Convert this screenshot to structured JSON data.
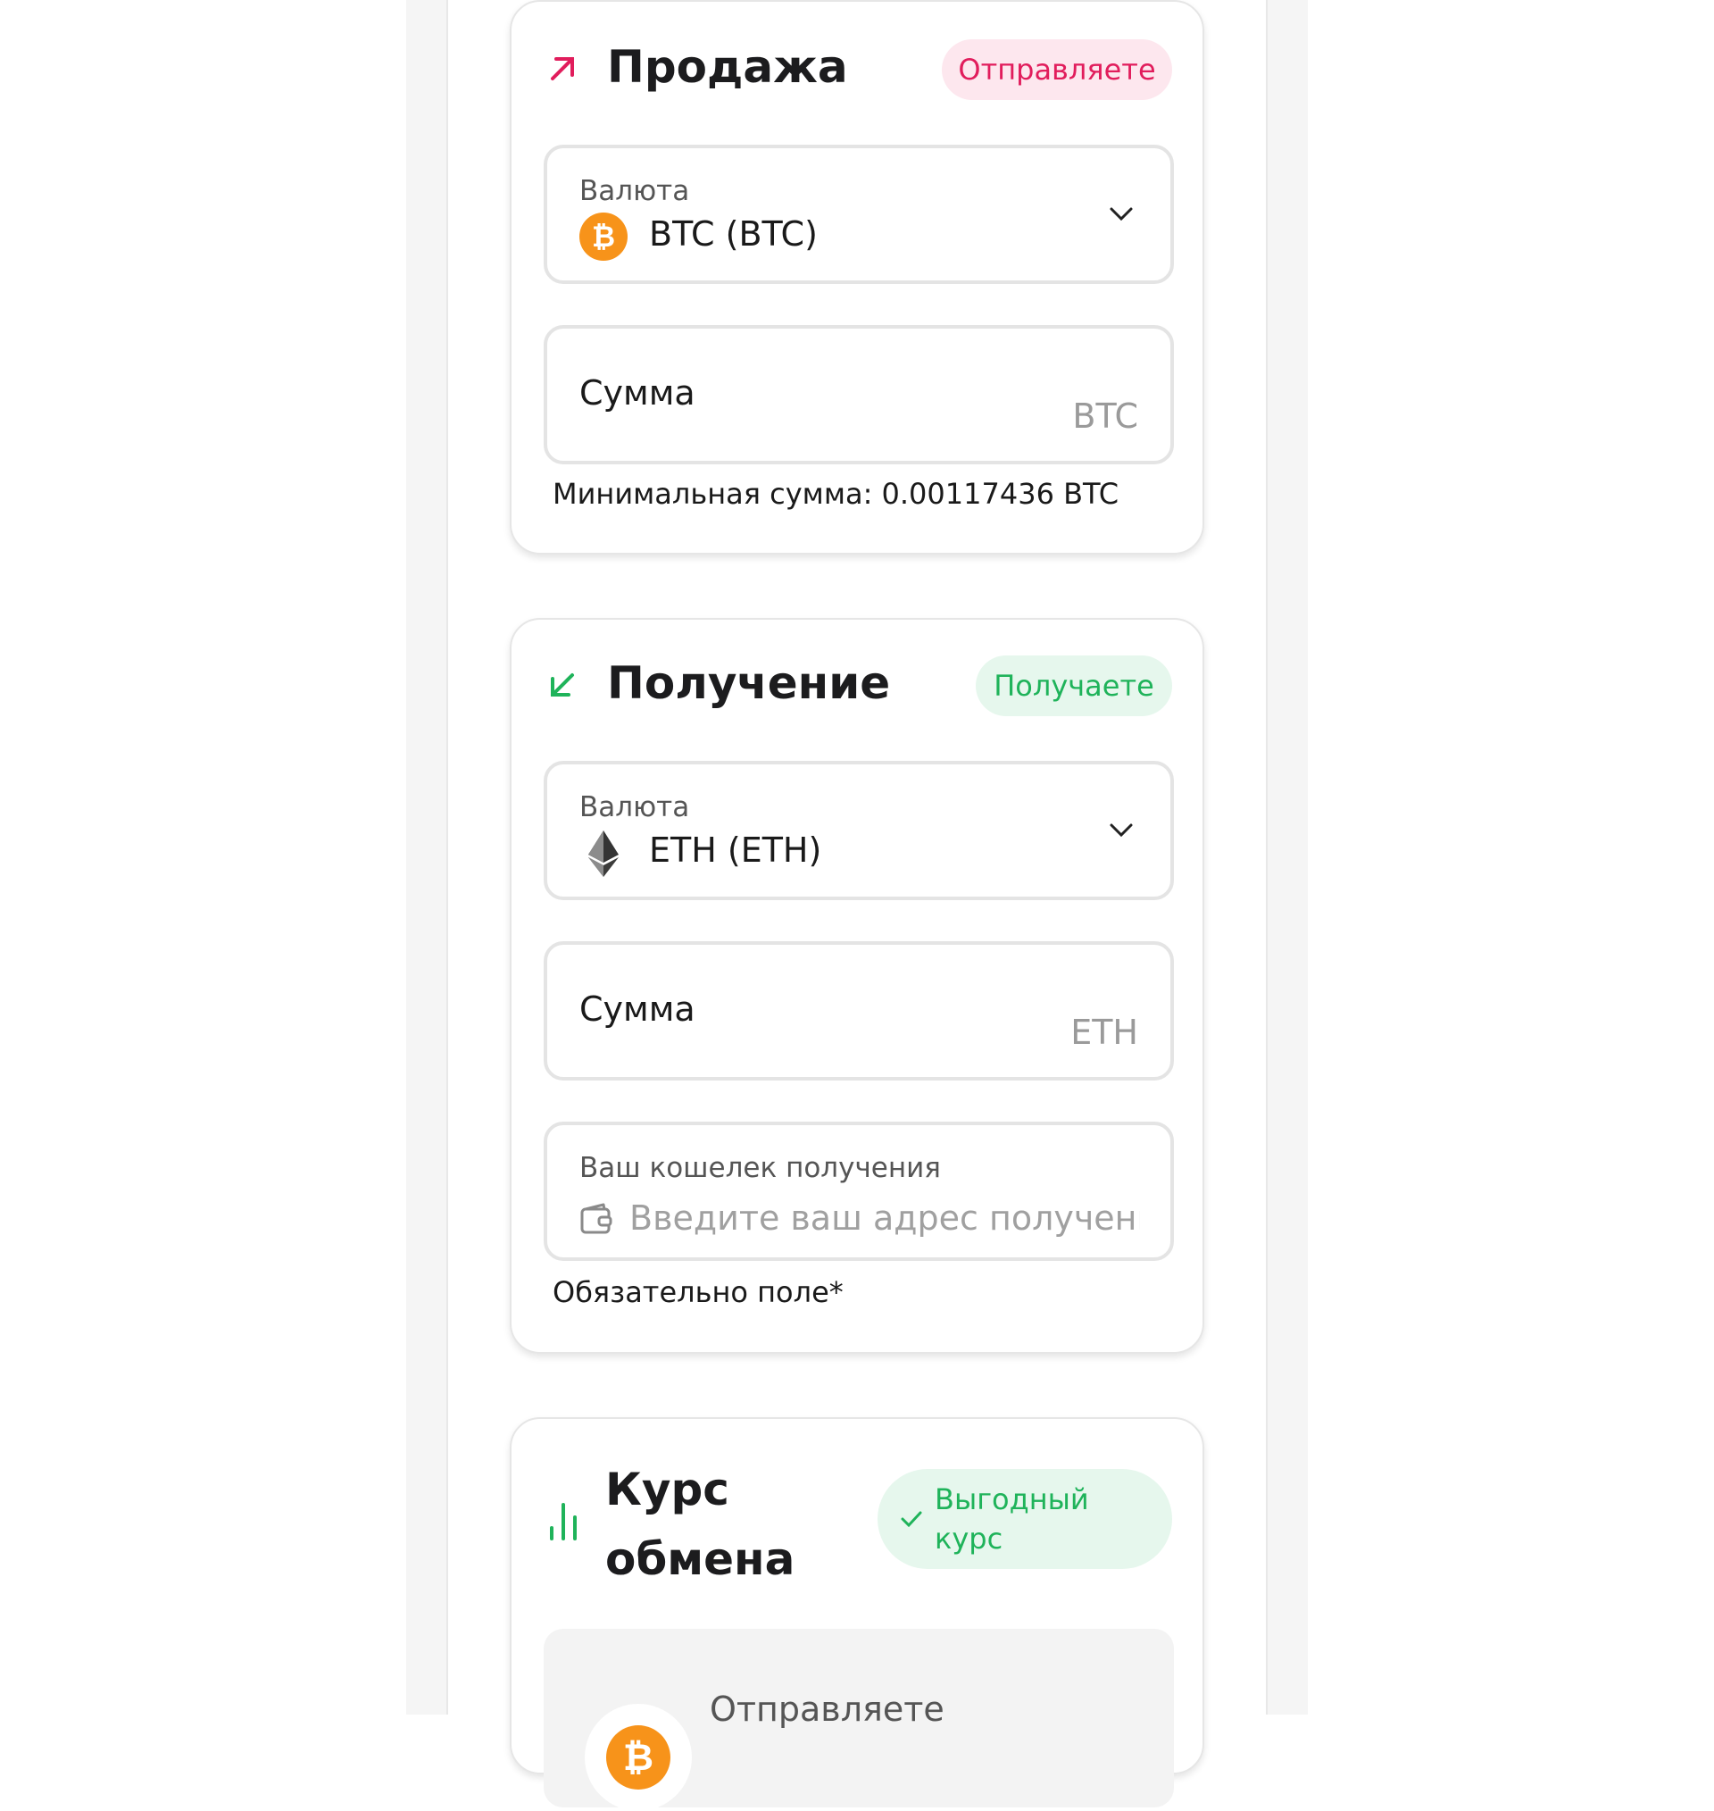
{
  "sell": {
    "title": "Продажа",
    "badge": "Отправляете",
    "currency_label": "Валюта",
    "currency_value": "BTC (BTC)",
    "amount_label": "Сумма",
    "amount_unit": "BTC",
    "min_amount_text": "Минимальная сумма: 0.00117436 BTC",
    "icon": "arrow-up-right-icon",
    "coin_icon": "bitcoin-icon",
    "accent": "#e11d5c"
  },
  "receive": {
    "title": "Получение",
    "badge": "Получаете",
    "currency_label": "Валюта",
    "currency_value": "ETH (ETH)",
    "amount_label": "Сумма",
    "amount_unit": "ETH",
    "wallet_label": "Ваш кошелек получения",
    "wallet_placeholder": "Введите ваш адрес получения",
    "required_text": "Обязательно поле*",
    "icon": "arrow-down-left-icon",
    "coin_icon": "ethereum-icon",
    "accent": "#1fb35a"
  },
  "rate": {
    "title": "Курс обмена",
    "badge": "Выгодный курс",
    "send_label": "Отправляете",
    "icon": "bar-chart-icon",
    "accent": "#1fb35a"
  }
}
